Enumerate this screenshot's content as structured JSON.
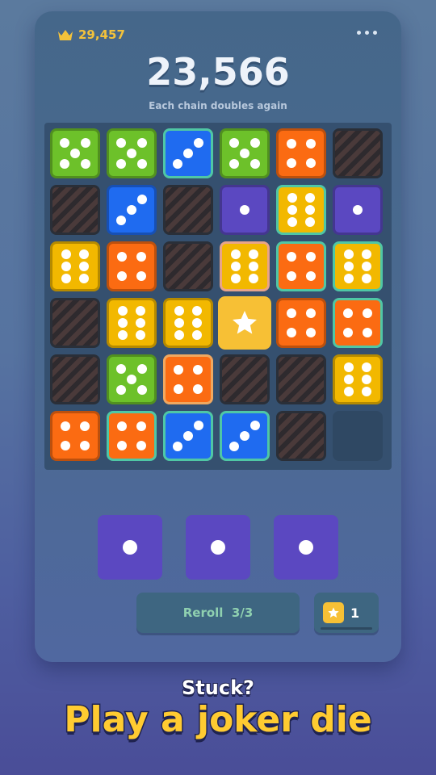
{
  "header": {
    "best_score": "29,457",
    "score": "23,566",
    "subtitle": "Each chain doubles again",
    "menu_icon": "more-dots-icon",
    "best_icon": "crown-icon"
  },
  "colors": {
    "green": "#6dc12a",
    "blue": "#1f6bf0",
    "orange": "#fb6b12",
    "yellow": "#f2b800",
    "purple": "#5b48c1",
    "joker": "#f7c035"
  },
  "board": {
    "rows": [
      [
        {
          "t": "die",
          "c": "green",
          "v": 5
        },
        {
          "t": "die",
          "c": "green",
          "v": 5
        },
        {
          "t": "die",
          "c": "blue",
          "v": 3,
          "hl": 1
        },
        {
          "t": "die",
          "c": "green",
          "v": 5
        },
        {
          "t": "die",
          "c": "orange",
          "v": 4
        },
        {
          "t": "blocked"
        }
      ],
      [
        {
          "t": "blocked"
        },
        {
          "t": "die",
          "c": "blue",
          "v": 3
        },
        {
          "t": "blocked"
        },
        {
          "t": "die",
          "c": "purple",
          "v": 1
        },
        {
          "t": "die",
          "c": "yellow",
          "v": 6,
          "hl": 1
        },
        {
          "t": "die",
          "c": "purple",
          "v": 1
        }
      ],
      [
        {
          "t": "die",
          "c": "yellow",
          "v": 6
        },
        {
          "t": "die",
          "c": "orange",
          "v": 4
        },
        {
          "t": "blocked"
        },
        {
          "t": "die",
          "c": "yellow",
          "v": 6,
          "hl": 2
        },
        {
          "t": "die",
          "c": "orange",
          "v": 4,
          "hl": 1
        },
        {
          "t": "die",
          "c": "yellow",
          "v": 6,
          "hl": 1
        }
      ],
      [
        {
          "t": "blocked"
        },
        {
          "t": "die",
          "c": "yellow",
          "v": 6
        },
        {
          "t": "die",
          "c": "yellow",
          "v": 6
        },
        {
          "t": "joker"
        },
        {
          "t": "die",
          "c": "orange",
          "v": 4
        },
        {
          "t": "die",
          "c": "orange",
          "v": 4,
          "hl": 1
        }
      ],
      [
        {
          "t": "blocked"
        },
        {
          "t": "die",
          "c": "green",
          "v": 5
        },
        {
          "t": "die",
          "c": "orange",
          "v": 4,
          "hl": 3
        },
        {
          "t": "blocked"
        },
        {
          "t": "blocked"
        },
        {
          "t": "die",
          "c": "yellow",
          "v": 6
        }
      ],
      [
        {
          "t": "die",
          "c": "orange",
          "v": 4
        },
        {
          "t": "die",
          "c": "orange",
          "v": 4,
          "hl": 1
        },
        {
          "t": "die",
          "c": "blue",
          "v": 3,
          "hl": 1
        },
        {
          "t": "die",
          "c": "blue",
          "v": 3,
          "hl": 1
        },
        {
          "t": "blocked"
        },
        {
          "t": "empty"
        }
      ]
    ]
  },
  "tray": [
    {
      "color": "purple",
      "value": 1
    },
    {
      "color": "purple",
      "value": 1
    },
    {
      "color": "purple",
      "value": 1
    }
  ],
  "controls": {
    "reroll_label": "Reroll",
    "reroll_count": "3/3",
    "joker_icon": "star-icon",
    "joker_count": "1"
  },
  "caption": {
    "line1": "Stuck?",
    "line2": "Play a joker die"
  }
}
